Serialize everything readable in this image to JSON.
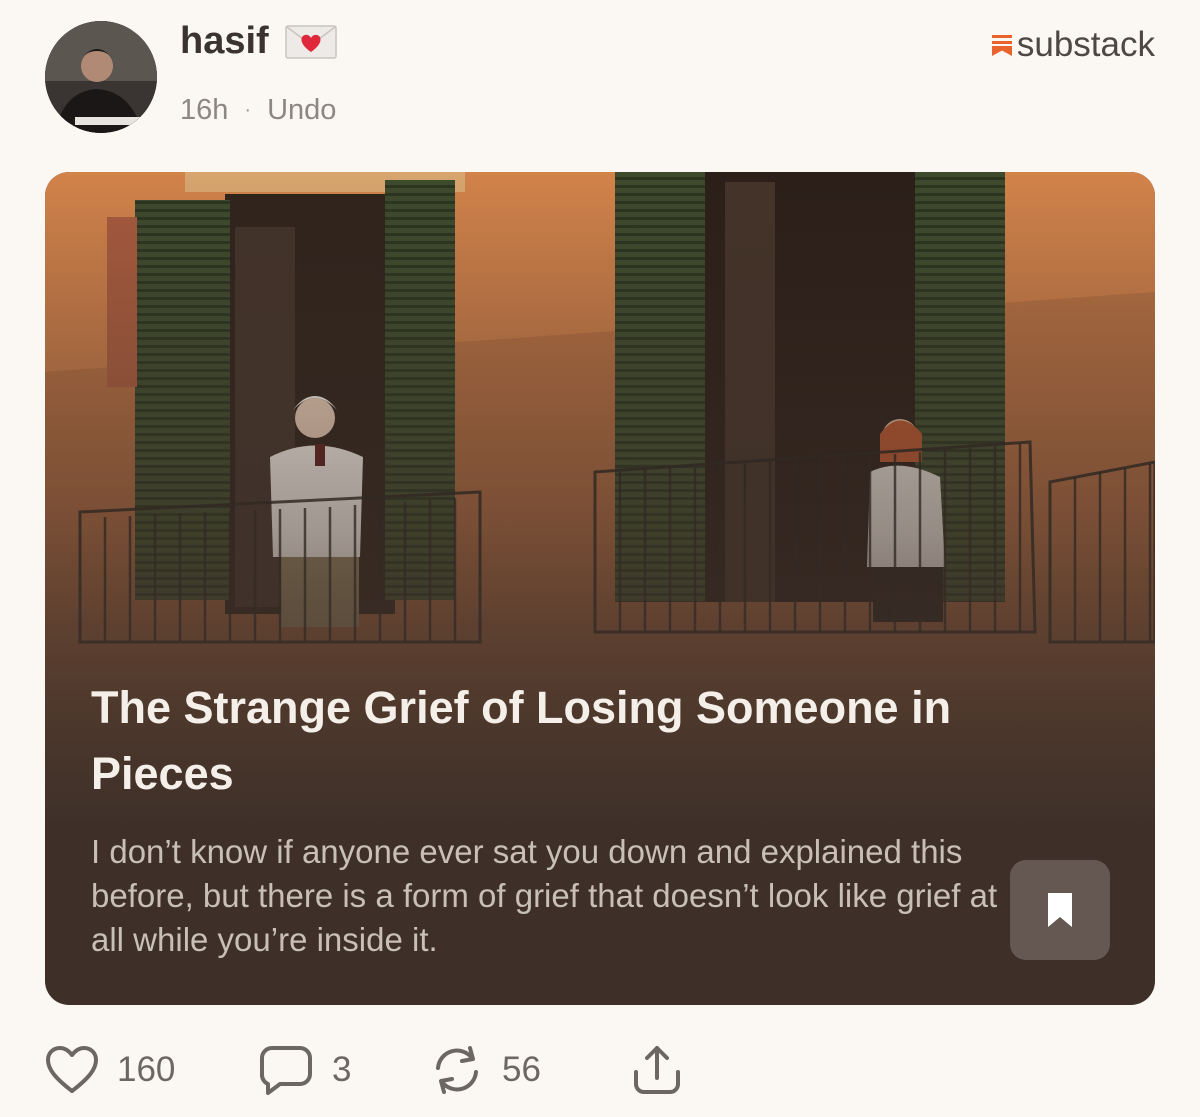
{
  "post": {
    "author": "hasif",
    "time": "16h",
    "separator": "·",
    "undo_label": "Undo",
    "brand": "substack",
    "brand_color": "#e8642c"
  },
  "card": {
    "title": "The Strange Grief of Losing Someone in Pieces",
    "description": "I don’t know if anyone ever sat you down and explained this before, but there is a form of grief that doesn’t look like grief at all while you’re inside it.",
    "image_icon": "photo-two-balconies",
    "bookmark_icon": "bookmark-icon"
  },
  "actions": {
    "likes": "160",
    "comments": "3",
    "restacks": "56",
    "icons": [
      "heart-icon",
      "comment-icon",
      "restack-icon",
      "share-icon"
    ]
  }
}
